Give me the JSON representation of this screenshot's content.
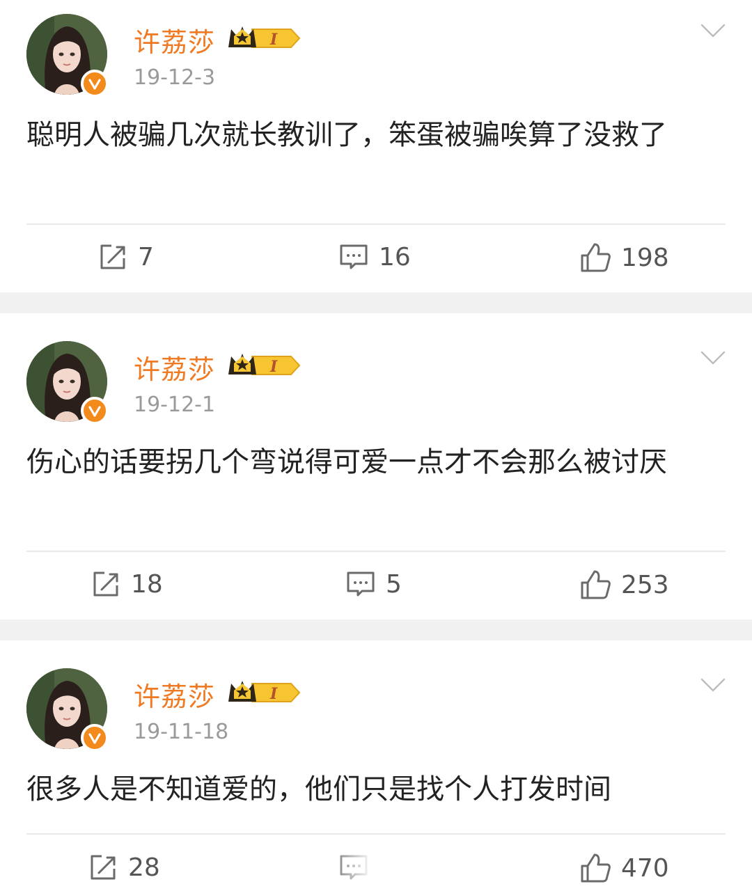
{
  "posts": [
    {
      "username": "许荔莎",
      "date": "19-12-3",
      "content": "聪明人被骗几次就长教训了，笨蛋被骗唉算了没救了",
      "reposts": "7",
      "comments": "16",
      "likes": "198"
    },
    {
      "username": "许荔莎",
      "date": "19-12-1",
      "content": "伤心的话要拐几个弯说得可爱一点才不会那么被讨厌",
      "reposts": "18",
      "comments": "5",
      "likes": "253"
    },
    {
      "username": "许荔莎",
      "date": "19-11-18",
      "content": "很多人是不知道爱的，他们只是找个人打发时间",
      "reposts": "28",
      "comments": "",
      "likes": "470"
    }
  ],
  "badge": {
    "vip_level": "I"
  },
  "colors": {
    "username": "#f07a23",
    "verified": "#f28a1c",
    "date": "#9a9a9a",
    "separator": "#f1f1f1"
  },
  "icons": {
    "repost": "repost-icon",
    "comment": "comment-icon",
    "like": "like-icon",
    "menu": "chevron-down-icon",
    "verified": "verified-icon",
    "vip": "crown-vip-icon"
  }
}
